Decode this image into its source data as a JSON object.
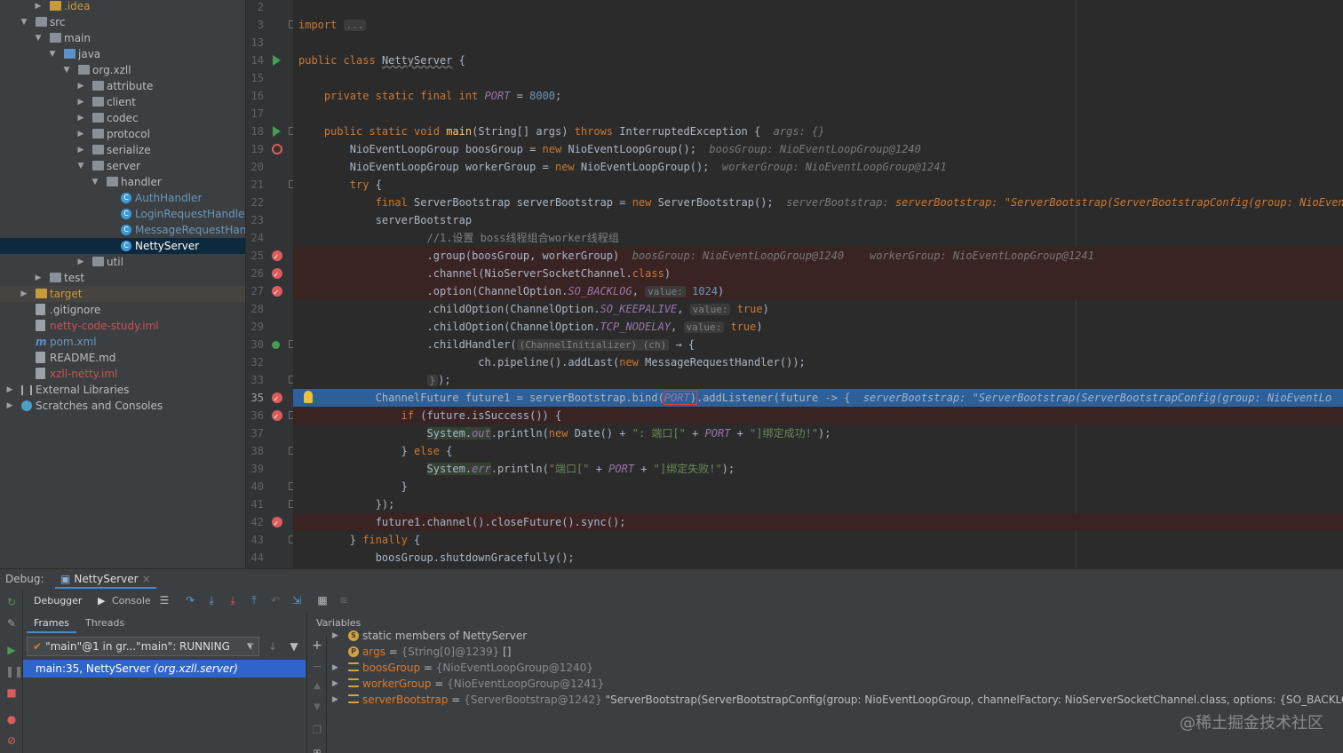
{
  "project_tree": {
    "items": [
      {
        "label": ".idea",
        "icon": "folder-icon",
        "color": "orange",
        "expanded": false
      },
      {
        "label": "src",
        "icon": "folder-icon",
        "color": "normal",
        "expanded": true
      },
      {
        "label": "main",
        "icon": "folder-icon",
        "color": "normal",
        "expanded": true
      },
      {
        "label": "java",
        "icon": "folder-icon",
        "color": "blue",
        "expanded": true
      },
      {
        "label": "org.xzll",
        "icon": "package-icon",
        "color": "normal",
        "expanded": true
      },
      {
        "label": "attribute",
        "icon": "package-icon",
        "color": "normal",
        "expanded": false
      },
      {
        "label": "client",
        "icon": "package-icon",
        "color": "normal",
        "expanded": false
      },
      {
        "label": "codec",
        "icon": "package-icon",
        "color": "normal",
        "expanded": false
      },
      {
        "label": "protocol",
        "icon": "package-icon",
        "color": "normal",
        "expanded": false
      },
      {
        "label": "serialize",
        "icon": "package-icon",
        "color": "normal",
        "expanded": false
      },
      {
        "label": "server",
        "icon": "package-icon",
        "color": "normal",
        "expanded": true
      },
      {
        "label": "handler",
        "icon": "package-icon",
        "color": "normal",
        "expanded": true
      },
      {
        "label": "AuthHandler",
        "icon": "class-icon",
        "color": "blue"
      },
      {
        "label": "LoginRequestHandler",
        "icon": "class-icon",
        "color": "blue"
      },
      {
        "label": "MessageRequestHand",
        "icon": "class-icon",
        "color": "blue"
      },
      {
        "label": "NettyServer",
        "icon": "class-icon",
        "color": "blue",
        "selected": true
      },
      {
        "label": "util",
        "icon": "package-icon",
        "color": "normal",
        "expanded": false
      },
      {
        "label": "test",
        "icon": "folder-icon",
        "color": "normal",
        "expanded": false
      },
      {
        "label": "target",
        "icon": "folder-icon",
        "color": "orange",
        "expanded": false
      },
      {
        "label": ".gitignore",
        "icon": "file-icon",
        "color": "normal"
      },
      {
        "label": "netty-code-study.iml",
        "icon": "file-icon",
        "color": "red"
      },
      {
        "label": "pom.xml",
        "icon": "maven-icon",
        "color": "blue"
      },
      {
        "label": "README.md",
        "icon": "file-icon",
        "color": "normal"
      },
      {
        "label": "xzll-netty.iml",
        "icon": "file-icon",
        "color": "red"
      },
      {
        "label": "External Libraries",
        "icon": "library-icon",
        "color": "normal",
        "expanded": false
      },
      {
        "label": "Scratches and Consoles",
        "icon": "scratch-icon",
        "color": "normal",
        "expanded": false
      }
    ]
  },
  "editor": {
    "line_numbers": [
      "2",
      "3",
      "13",
      "14",
      "15",
      "16",
      "17",
      "18",
      "19",
      "20",
      "21",
      "22",
      "23",
      "24",
      "25",
      "26",
      "27",
      "28",
      "29",
      "30",
      "32",
      "33",
      "35",
      "36",
      "37",
      "38",
      "39",
      "40",
      "41",
      "42",
      "43",
      "44"
    ],
    "current_line": "35",
    "hints": {
      "args": "args: {}",
      "boos": "boosGroup: NioEventLoopGroup@1240",
      "worker": "workerGroup: NioEventLoopGroup@1241",
      "sb": "serverBootstrap: \"ServerBootstrap(ServerBootstrapConfig(group: NioEventLoopGroup, chc",
      "group": "boosGroup: NioEventLoopGroup@1240    workerGroup: NioEventLoopGroup@1241",
      "value": "value:",
      "sb35": "serverBootstrap: \"ServerBootstrap(ServerBootstrapConfig(group: NioEventLo"
    }
  },
  "debug": {
    "label": "Debug:",
    "tab": "NettyServer",
    "toolbar": {
      "debugger": "Debugger",
      "console": "Console"
    },
    "frames_tab": "Frames",
    "threads_tab": "Threads",
    "thread_selector": "\"main\"@1 in gr...\"main\": RUNNING",
    "selected_frame": {
      "location": "main:35, NettyServer",
      "package": "(org.xzll.server)"
    },
    "variables_header": "Variables",
    "variables": [
      {
        "name": "static",
        "rest": " members of NettyServer",
        "type": "",
        "value": "",
        "icon": "static-icon",
        "expandable": true
      },
      {
        "name": "args",
        "rest": " = ",
        "type": "{String[0]@1239}",
        "value": " []",
        "icon": "param-icon",
        "expandable": false
      },
      {
        "name": "boosGroup",
        "rest": " = ",
        "type": "{NioEventLoopGroup@1240}",
        "value": "",
        "icon": "local-var-icon",
        "expandable": true
      },
      {
        "name": "workerGroup",
        "rest": " = ",
        "type": "{NioEventLoopGroup@1241}",
        "value": "",
        "icon": "local-var-icon",
        "expandable": true
      },
      {
        "name": "serverBootstrap",
        "rest": " = ",
        "type": "{ServerBootstrap@1242}",
        "value": " \"ServerBootstrap(ServerBootstrapConfig(group: NioEventLoopGroup, channelFactory: NioServerSocketChannel.class, options: {SO_BACKLOG=1024}, childG",
        "icon": "local-var-icon",
        "expandable": true
      }
    ]
  },
  "watermark": "@稀土掘金技术社区",
  "colors": {
    "selection": "#2d6099",
    "breakpoint": "#db5c5c",
    "keyword": "#cc7832"
  }
}
